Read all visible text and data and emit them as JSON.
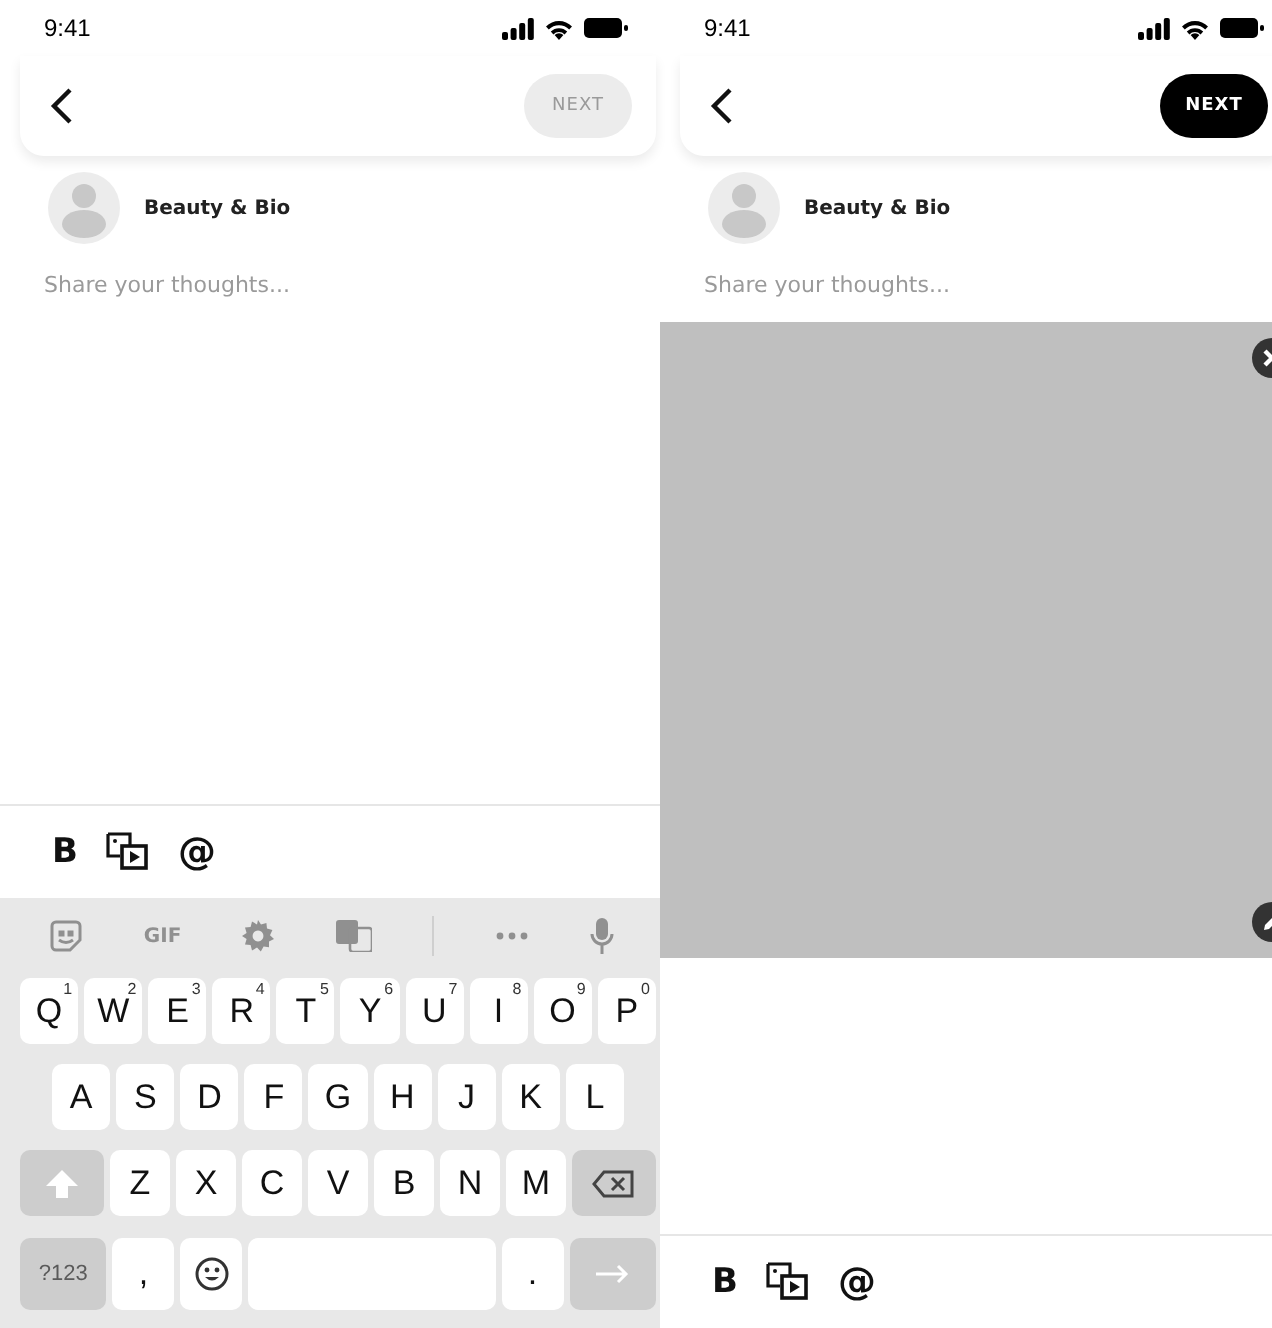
{
  "screens": [
    {
      "status_time": "9:41",
      "next_button": {
        "label": "NEXT",
        "disabled": true
      },
      "author": "Beauty & Bio",
      "post_field": {
        "placeholder": "Share your thoughts..."
      },
      "toolbar": {
        "bold": "B",
        "mention": "@"
      },
      "keyboard": {
        "strip_label": "GIF",
        "rows": [
          [
            {
              "label": "Q",
              "hint": "1"
            },
            {
              "label": "W",
              "hint": "2"
            },
            {
              "label": "E",
              "hint": "3"
            },
            {
              "label": "R",
              "hint": "4"
            },
            {
              "label": "T",
              "hint": "5"
            },
            {
              "label": "Y",
              "hint": "6"
            },
            {
              "label": "U",
              "hint": "7"
            },
            {
              "label": "I",
              "hint": "8"
            },
            {
              "label": "O",
              "hint": "9"
            },
            {
              "label": "P",
              "hint": "0"
            }
          ],
          [
            {
              "label": "A"
            },
            {
              "label": "S"
            },
            {
              "label": "D"
            },
            {
              "label": "F"
            },
            {
              "label": "G"
            },
            {
              "label": "H"
            },
            {
              "label": "J"
            },
            {
              "label": "K"
            },
            {
              "label": "L"
            }
          ],
          [
            {
              "kind": "shift"
            },
            {
              "label": "Z"
            },
            {
              "label": "X"
            },
            {
              "label": "C"
            },
            {
              "label": "V"
            },
            {
              "label": "B"
            },
            {
              "label": "N"
            },
            {
              "label": "M"
            },
            {
              "kind": "backspace"
            }
          ]
        ],
        "bottom_row": {
          "symbols_key": "?123",
          "comma_key": ",",
          "period_key": "."
        }
      }
    },
    {
      "status_time": "9:41",
      "next_button": {
        "label": "NEXT",
        "disabled": false
      },
      "author": "Beauty & Bio",
      "post_field": {
        "placeholder": "Share your thoughts..."
      },
      "toolbar": {
        "bold": "B",
        "mention": "@"
      }
    }
  ]
}
